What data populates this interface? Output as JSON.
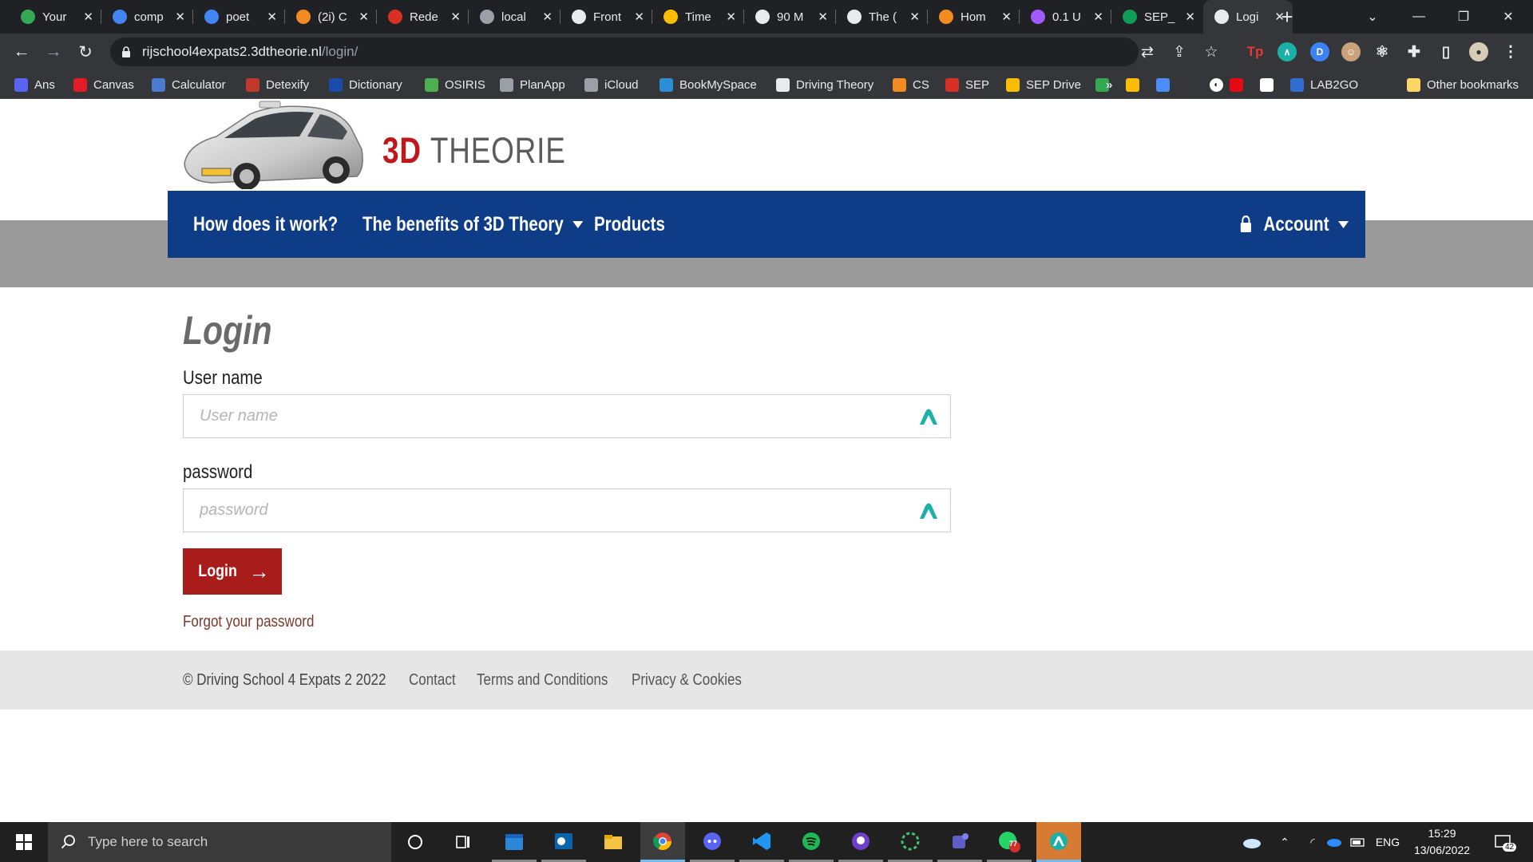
{
  "browser": {
    "tabs": [
      {
        "title": "Your",
        "favicon": "spiral-icon",
        "color": "#34a853"
      },
      {
        "title": "comp",
        "favicon": "google-icon",
        "color": "#4285f4"
      },
      {
        "title": "poet",
        "favicon": "google-icon",
        "color": "#4285f4"
      },
      {
        "title": "(2i) C",
        "favicon": "dots-icon",
        "color": "#f28b21"
      },
      {
        "title": "Rede",
        "favicon": "doc-icon",
        "color": "#d93025"
      },
      {
        "title": "local",
        "favicon": "globe-icon",
        "color": "#9aa0a6"
      },
      {
        "title": "Front",
        "favicon": "loop-icon",
        "color": "#e8eaed"
      },
      {
        "title": "Time",
        "favicon": "drive-icon",
        "color": "#fbbc04"
      },
      {
        "title": "90 M",
        "favicon": "m-icon",
        "color": "#e8eaed"
      },
      {
        "title": "The (",
        "favicon": "u-icon",
        "color": "#e8eaed"
      },
      {
        "title": "Hom",
        "favicon": "arc-icon",
        "color": "#f28b21"
      },
      {
        "title": "0.1 U",
        "favicon": "figma-icon",
        "color": "#a259ff"
      },
      {
        "title": "SEP_",
        "favicon": "sheets-plus-icon",
        "color": "#0f9d58"
      },
      {
        "title": "Logi",
        "favicon": "page-icon",
        "color": "#e8eaed"
      }
    ],
    "new_tab": "+",
    "url_host": "rijschool4expats2.3dtheorie.nl",
    "url_path": "/login/",
    "bookmarks": [
      {
        "label": "Ans",
        "icon": "ans-icon",
        "color": "#5865f2"
      },
      {
        "label": "Canvas",
        "icon": "canvas-icon",
        "color": "#e31b23"
      },
      {
        "label": "Calculator",
        "icon": "calculator-icon",
        "color": "#4a7bd0"
      },
      {
        "label": "Detexify",
        "icon": "detexify-icon",
        "color": "#c0392b"
      },
      {
        "label": "Dictionary",
        "icon": "dictionary-icon",
        "color": "#1a4dab"
      },
      {
        "label": "OSIRIS",
        "icon": "osiris-icon",
        "color": "#4caf50"
      },
      {
        "label": "PlanApp",
        "icon": "planapp-icon",
        "color": "#9aa0a6"
      },
      {
        "label": "iCloud",
        "icon": "apple-icon",
        "color": "#9aa0a6"
      },
      {
        "label": "BookMySpace",
        "icon": "bookmyspace-icon",
        "color": "#2b8fd6"
      },
      {
        "label": "Driving Theory",
        "icon": "page-icon",
        "color": "#e8eaed"
      },
      {
        "label": "CS",
        "icon": "dots-icon",
        "color": "#f28b21"
      },
      {
        "label": "SEP",
        "icon": "doc-icon",
        "color": "#d93025"
      },
      {
        "label": "SEP Drive",
        "icon": "drive-icon",
        "color": "#fbbc04"
      },
      {
        "label": "LAB2GO",
        "icon": "z-icon",
        "color": "#2f6dd0"
      }
    ],
    "more_bookmarks": "»",
    "other_bookmarks": "Other bookmarks"
  },
  "site": {
    "logo_number": "3D",
    "logo_word": "THEORIE",
    "nav": {
      "how": "How does it work?",
      "benefits": "The benefits of 3D Theory",
      "products": "Products",
      "account": "Account"
    },
    "login": {
      "title": "Login",
      "username_label": "User name",
      "username_placeholder": "User name",
      "password_label": "password",
      "password_placeholder": "password",
      "button_label": "Login",
      "forgot": "Forgot your password"
    },
    "footer": {
      "copyright": "© Driving School 4 Expats 2 2022",
      "contact": "Contact",
      "terms": "Terms and Conditions",
      "privacy": "Privacy & Cookies"
    },
    "colors": {
      "nav_blue": "#0e3c86",
      "brand_red": "#c0161c",
      "button_red": "#a81c1c"
    }
  },
  "taskbar": {
    "search_placeholder": "Type here to search",
    "language": "ENG",
    "time": "15:29",
    "date": "13/06/2022",
    "notification_count": "42",
    "whatsapp_badge": "77"
  }
}
